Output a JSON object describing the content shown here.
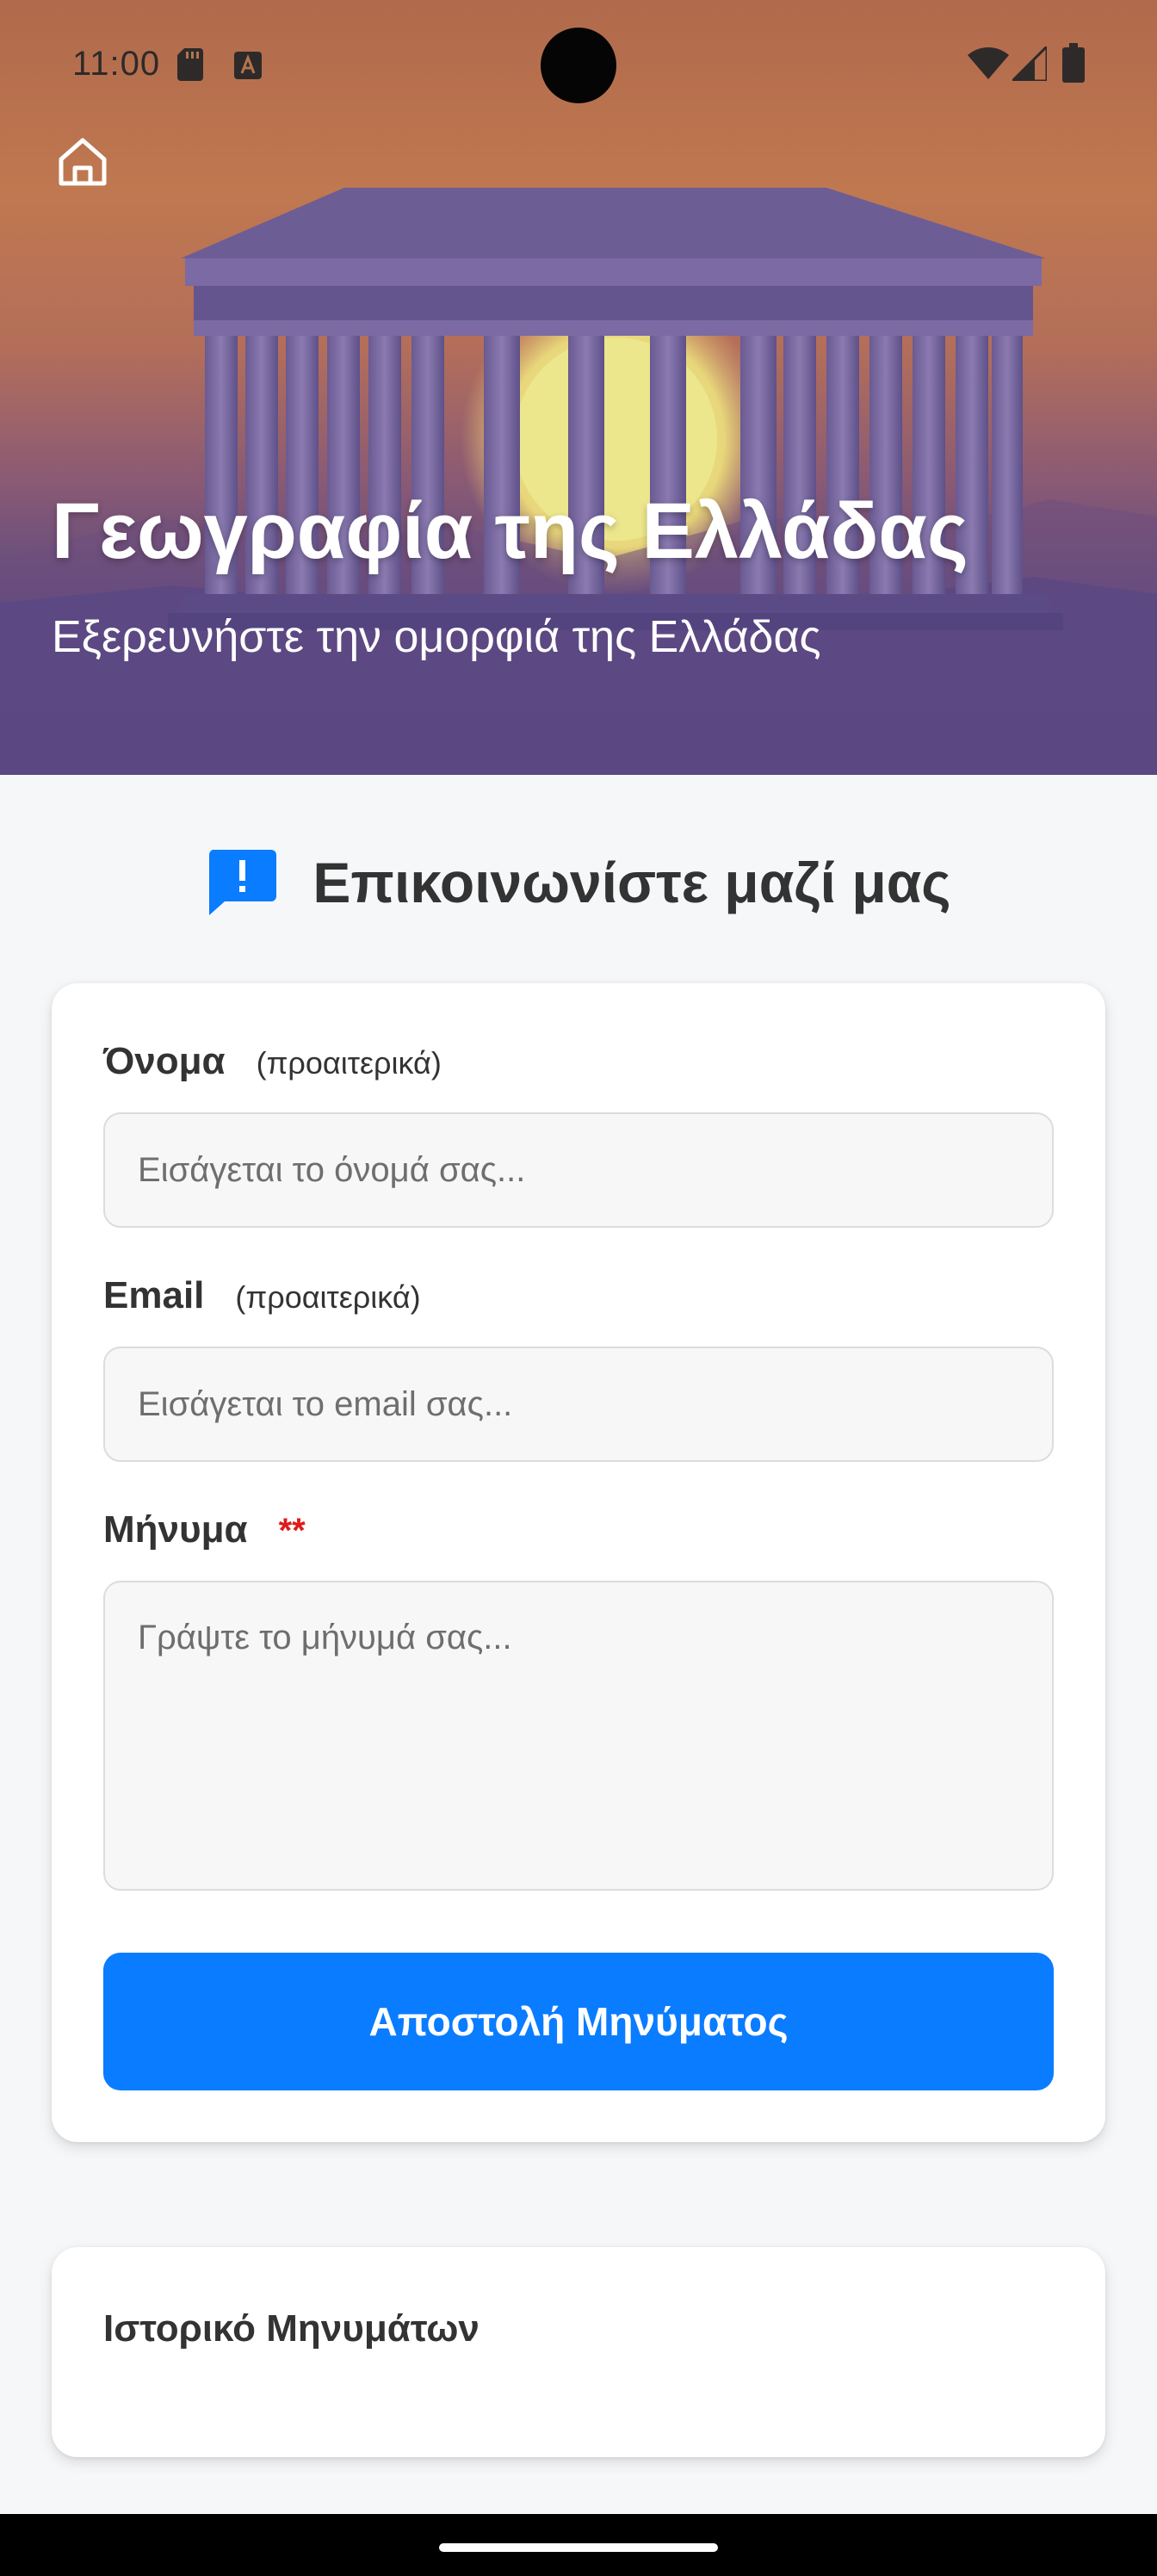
{
  "status_bar": {
    "time": "11:00"
  },
  "hero": {
    "title": "Γεωγραφία της Ελλάδας",
    "subtitle": "Εξερευνήστε την ομορφιά της Ελλάδας",
    "home_icon": "home-icon"
  },
  "contact": {
    "heading": "Επικοινωνίστε μαζί μας",
    "heading_icon": "feedback-icon",
    "name": {
      "label": "Όνομα",
      "note": "(προαιτερικά)",
      "placeholder": "Εισάγεται το όνομά σας...",
      "value": ""
    },
    "email": {
      "label": "Email",
      "note": "(προαιτερικά)",
      "placeholder": "Εισάγεται το email σας...",
      "value": ""
    },
    "message": {
      "label": "Μήνυμα",
      "required_mark": "**",
      "placeholder": "Γράψτε το μήνυμά σας...",
      "value": ""
    },
    "submit_label": "Αποστολή Μηνύματος"
  },
  "history": {
    "title": "Ιστορικό Μηνυμάτων"
  },
  "colors": {
    "accent": "#0a7cff",
    "required": "#e01a1a",
    "card": "#ffffff",
    "background": "#f6f7f9",
    "hero_bottom": "#4f4382"
  }
}
